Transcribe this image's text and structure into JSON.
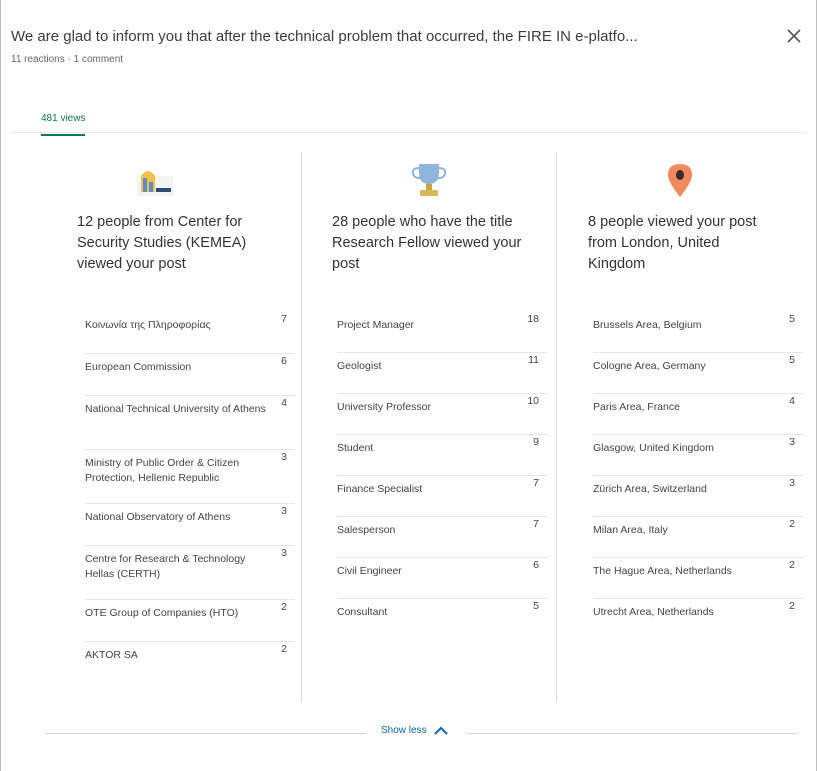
{
  "header": {
    "title": "We are glad to inform you that after the technical problem that occurred, the FIRE IN e-platfo...",
    "subtitle": "11 reactions · 1 comment"
  },
  "tabs": [
    {
      "label": "481 views",
      "active": true
    }
  ],
  "columns": [
    {
      "icon": "company-logo-icon",
      "heading": "12 people from Center for Security Studies (KEMEA) viewed your post",
      "rows": [
        {
          "label": "Κοινωνία της Πληροφορίας",
          "count": "7"
        },
        {
          "label": "European Commission",
          "count": "6"
        },
        {
          "label": "National Technical University of Athens",
          "count": "4"
        },
        {
          "label": "Ministry of Public Order & Citizen Protection, Hellenic Republic",
          "count": "3"
        },
        {
          "label": "National Observatory of Athens",
          "count": "3"
        },
        {
          "label": "Centre for Research & Technology Hellas (CERTH)",
          "count": "3"
        },
        {
          "label": "OTE Group of Companies (HTO)",
          "count": "2"
        },
        {
          "label": "AKTOR SA",
          "count": "2"
        }
      ]
    },
    {
      "icon": "trophy-icon",
      "heading": "28 people who have the title Research Fellow viewed your post",
      "rows": [
        {
          "label": "Project Manager",
          "count": "18"
        },
        {
          "label": "Geologist",
          "count": "11"
        },
        {
          "label": "University Professor",
          "count": "10"
        },
        {
          "label": "Student",
          "count": "9"
        },
        {
          "label": "Finance Specialist",
          "count": "7"
        },
        {
          "label": "Salesperson",
          "count": "7"
        },
        {
          "label": "Civil Engineer",
          "count": "6"
        },
        {
          "label": "Consultant",
          "count": "5"
        }
      ]
    },
    {
      "icon": "location-pin-icon",
      "heading": "8 people viewed your post from London, United Kingdom",
      "rows": [
        {
          "label": "Brussels Area, Belgium",
          "count": "5"
        },
        {
          "label": "Cologne Area, Germany",
          "count": "5"
        },
        {
          "label": "Paris Area, France",
          "count": "4"
        },
        {
          "label": "Glasgow, United Kingdom",
          "count": "3"
        },
        {
          "label": "Zürich Area, Switzerland",
          "count": "3"
        },
        {
          "label": "Milan Area, Italy",
          "count": "2"
        },
        {
          "label": "The Hague Area, Netherlands",
          "count": "2"
        },
        {
          "label": "Utrecht Area, Netherlands",
          "count": "2"
        }
      ]
    }
  ],
  "footer": {
    "show_less_label": "Show less"
  },
  "colors": {
    "accent_green": "#0a7c52",
    "link_blue": "#0a66c2",
    "pin_orange": "#e8734a",
    "trophy_blue": "#6a9cc9"
  }
}
